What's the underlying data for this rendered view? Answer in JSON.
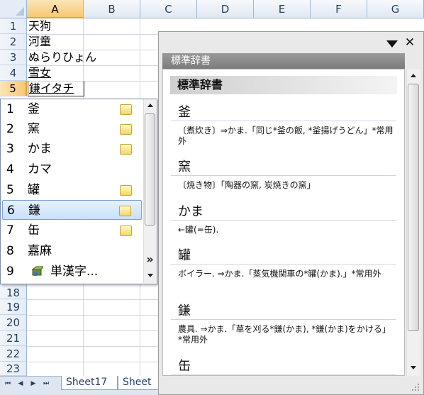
{
  "columns": [
    "A",
    "B",
    "C",
    "D",
    "E",
    "F",
    "G"
  ],
  "rows": [
    "1",
    "2",
    "3",
    "4",
    "5",
    "18",
    "19",
    "20",
    "21",
    "22",
    "23"
  ],
  "cells": [
    "天狗",
    "河童",
    "ぬらりひょん",
    "雪女",
    "鎌イタチ"
  ],
  "sheet_tabs": [
    "Sheet17",
    "Sheet"
  ],
  "ime": {
    "candidates": [
      {
        "num": "1",
        "text": "釜",
        "memo": true
      },
      {
        "num": "2",
        "text": "窯",
        "memo": true
      },
      {
        "num": "3",
        "text": "かま",
        "memo": true
      },
      {
        "num": "4",
        "text": "カマ",
        "memo": false
      },
      {
        "num": "5",
        "text": "罐",
        "memo": true
      },
      {
        "num": "6",
        "text": "鎌",
        "memo": true
      },
      {
        "num": "7",
        "text": "缶",
        "memo": true
      },
      {
        "num": "8",
        "text": "嘉麻",
        "memo": false
      },
      {
        "num": "9",
        "text": "単漢字...",
        "memo": false
      }
    ],
    "selected_index": 5,
    "more_label": "»"
  },
  "dictionary": {
    "title_bar": "標準辞書",
    "heading": "標準辞書",
    "close_label": "✕",
    "entries": [
      {
        "word": "釜",
        "def": "〔煮炊き〕⇒かま.「同じ*釜の飯, *釜揚げうどん」*常用外"
      },
      {
        "word": "窯",
        "def": "〔焼き物〕「陶器の窯, 炭焼きの窯」"
      },
      {
        "word": "かま",
        "def": "←罐(=缶)."
      },
      {
        "word": "罐",
        "def": "ボイラー. ⇒かま.「蒸気機関車の*罐(かま).」*常用外"
      },
      {
        "word": "鎌",
        "def": "農具. ⇒かま.「草を刈る*鎌(かま), *鎌(かま)をかける」*常用外"
      },
      {
        "word": "缶",
        "def": ""
      }
    ]
  },
  "colors": {
    "selected_header": "#f7c872",
    "dict_titlebar": "#8a8a8a",
    "candidate_selected": "#c9e0fb"
  }
}
